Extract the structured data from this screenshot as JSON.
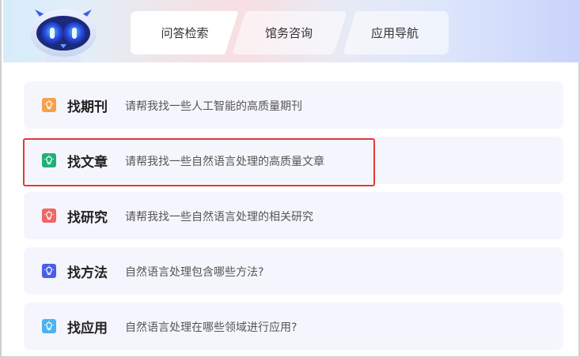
{
  "tabs": [
    {
      "label": "问答检索"
    },
    {
      "label": "馆务咨询"
    },
    {
      "label": "应用导航"
    }
  ],
  "cards": [
    {
      "title": "找期刊",
      "desc": "请帮我找一些人工智能的高质量期刊",
      "icon": "lightbulb-icon",
      "color": "#f5a04a"
    },
    {
      "title": "找文章",
      "desc": "请帮我找一些自然语言处理的高质量文章",
      "icon": "lightbulb-icon",
      "color": "#1fb07a"
    },
    {
      "title": "找研究",
      "desc": "请帮我找一些自然语言处理的相关研究",
      "icon": "lightbulb-icon",
      "color": "#ee6666"
    },
    {
      "title": "找方法",
      "desc": "自然语言处理包含哪些方法?",
      "icon": "lightbulb-icon",
      "color": "#4b5ee6"
    },
    {
      "title": "找应用",
      "desc": "自然语言处理在哪些领域进行应用?",
      "icon": "lightbulb-icon",
      "color": "#4ab3f0"
    }
  ],
  "selected_card": "找文章",
  "colors": {
    "highlight": "#e03a3a",
    "card_bg": "#f5f6fd"
  }
}
